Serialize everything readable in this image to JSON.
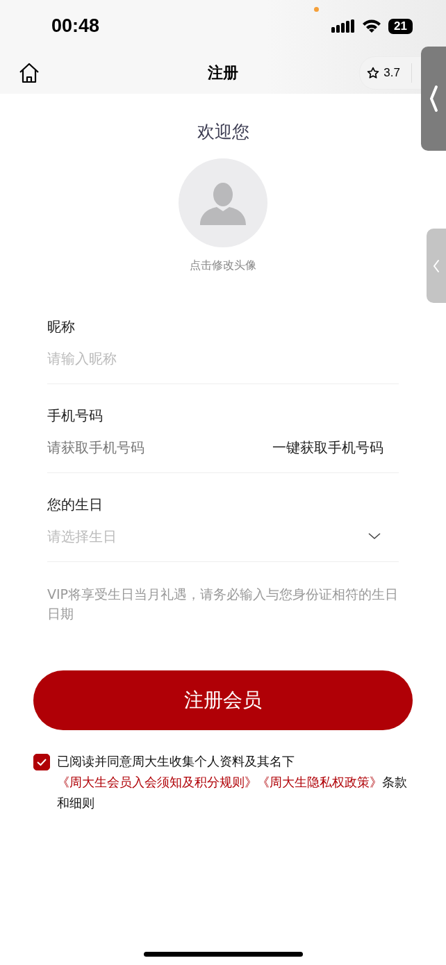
{
  "status_bar": {
    "time": "00:48",
    "battery": "21"
  },
  "nav": {
    "title": "注册",
    "rating": "3.7"
  },
  "welcome": "欢迎您",
  "avatar_hint": "点击修改头像",
  "fields": [
    {
      "kind": "text",
      "label": "昵称",
      "placeholder": "请输入昵称"
    },
    {
      "kind": "phone",
      "label": "手机号码",
      "placeholder": "请获取手机号码",
      "action": "一键获取手机号码"
    },
    {
      "kind": "select",
      "label": "您的生日",
      "placeholder": "请选择生日"
    }
  ],
  "birthday_note": "VIP将享受生日当月礼遇，请务必输入与您身份证相符的生日日期",
  "submit": "注册会员",
  "agreement": {
    "checked": true,
    "prefix": "已阅读并同意周大生收集个人资料及其名下",
    "links": [
      "《周大生会员入会须知及积分规则》",
      "《周大生隐私权政策》"
    ],
    "suffix": "条款和细则"
  }
}
